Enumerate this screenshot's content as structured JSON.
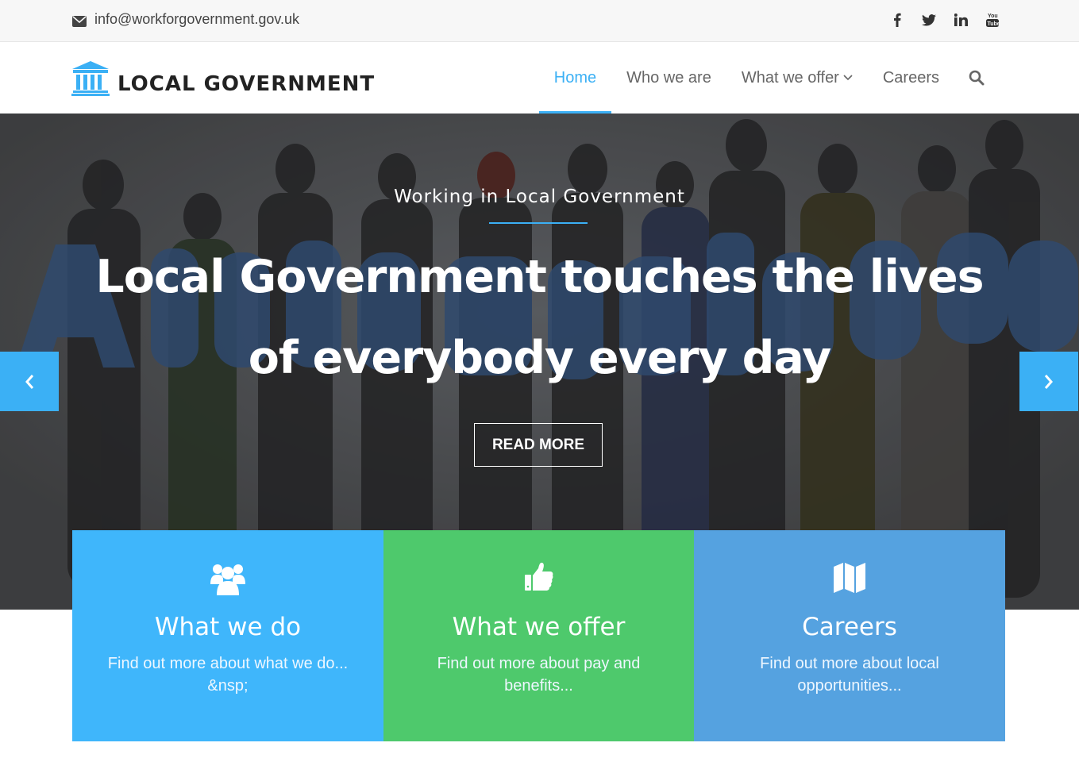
{
  "topbar": {
    "email": "info@workforgovernment.gov.uk",
    "social": [
      {
        "icon": "facebook-icon",
        "glyph": "f"
      },
      {
        "icon": "twitter-icon",
        "glyph": "t"
      },
      {
        "icon": "linkedin-icon",
        "glyph": "in"
      },
      {
        "icon": "youtube-icon",
        "glyph": "You Tube"
      }
    ]
  },
  "header": {
    "logo_text": "LOCAL GOVERNMENT",
    "nav": {
      "home": "Home",
      "who_we_are": "Who we are",
      "what_we_offer": "What we offer",
      "careers": "Careers"
    }
  },
  "hero": {
    "subtitle": "Working in Local Government",
    "title": "Local Government touches the lives of everybody every day",
    "button": "READ MORE"
  },
  "features": [
    {
      "title": "What we do",
      "description": "Find out more about what we do... &nsp;",
      "icon": "users-icon",
      "color": "#3fb6fb"
    },
    {
      "title": "What we offer",
      "description": "Find out more about pay and benefits...",
      "icon": "thumbs-up-icon",
      "color": "#4ec96c"
    },
    {
      "title": "Careers",
      "description": "Find out more about local opportunities...",
      "icon": "map-icon",
      "color": "#55a2e0"
    }
  ],
  "colors": {
    "accent": "#3bb0f5"
  }
}
